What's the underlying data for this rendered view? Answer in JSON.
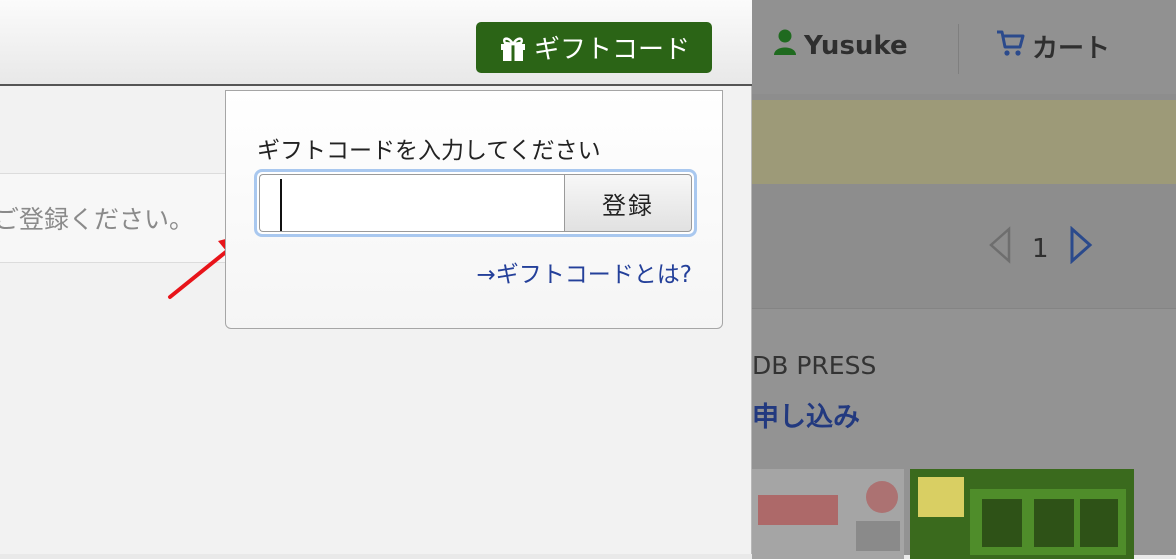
{
  "header": {
    "gift_button_label": "ギフトコード",
    "user_name": "Yusuke",
    "cart_label": "カート"
  },
  "main": {
    "field_text": "ご登録ください。"
  },
  "popover": {
    "label": "ギフトコードを入力してください",
    "input_value": "",
    "submit_label": "登録",
    "about_link": "→ギフトコードとは?"
  },
  "right_panel": {
    "page_number": "1",
    "item_title": "DB PRESS",
    "apply_link": "申し込み"
  },
  "colors": {
    "gift_button_bg": "#2b6416",
    "link_color": "#24409a",
    "focus_ring": "#a9c8ef",
    "annotation_arrow": "#e8141a"
  },
  "icons": {
    "gift": "gift-icon",
    "user": "user-icon",
    "cart": "cart-icon",
    "prev": "chevron-left-icon",
    "next": "chevron-right-icon"
  }
}
